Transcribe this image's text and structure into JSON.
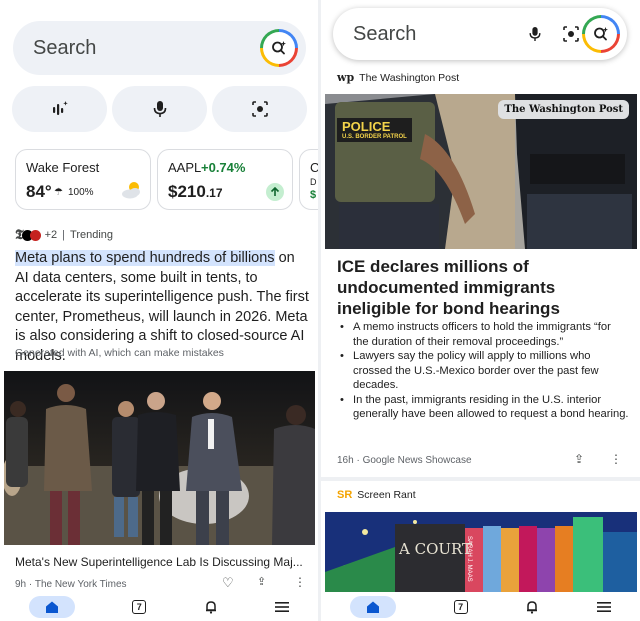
{
  "left": {
    "search": {
      "placeholder": "Search"
    },
    "weather": {
      "location": "Wake Forest",
      "temp": "84°",
      "precip": "100%"
    },
    "stock": {
      "symbol": "AAPL",
      "change": "+0.74%",
      "price_main": "$210",
      "price_cents": ".17"
    },
    "third_card": {
      "l1": "C",
      "l2": "D",
      "l3": "$"
    },
    "story": {
      "source_extra": "+2",
      "topic": "Trending",
      "highlight": "Meta plans to spend hundreds of billions",
      "body": " on AI data centers, some built in tents, to accelerate its superintelligence push. The first center, Prometheus, will launch in 2026. Meta is also considering a shift to closed-source AI models.",
      "ai_note": "Generated with AI, which can make mistakes",
      "caption": "Meta's New Superintelligence Lab Is Discussing Maj...",
      "meta": "9h · The New York Times"
    },
    "nav": {
      "badge": "7"
    }
  },
  "right": {
    "search": {
      "placeholder": "Search"
    },
    "publisher1": "The Washington Post",
    "photo_sign": "The Washington Post",
    "vest_text1": "POLICE",
    "vest_text2": "U.S. BORDER PATROL",
    "headline": "ICE declares millions of undocumented immigrants ineligible for bond hearings",
    "bullets": [
      "A memo instructs officers to hold the immigrants “for the duration of their removal proceedings.”",
      "Lawyers say the policy will apply to millions who crossed the U.S.-Mexico border over the past few decades.",
      "In the past, immigrants residing in the U.S. interior generally have been allowed to request a bond hearing."
    ],
    "meta": "16h · Google News Showcase",
    "publisher2": "Screen Rant",
    "book_text": "A COURT",
    "book_spine": "SARAH J. MAAS",
    "nav": {
      "badge": "7"
    }
  },
  "colors": {
    "accent": "#0b57d0",
    "active_pill": "#d3e3fd",
    "surface": "#eef1f6",
    "positive": "#188038"
  }
}
